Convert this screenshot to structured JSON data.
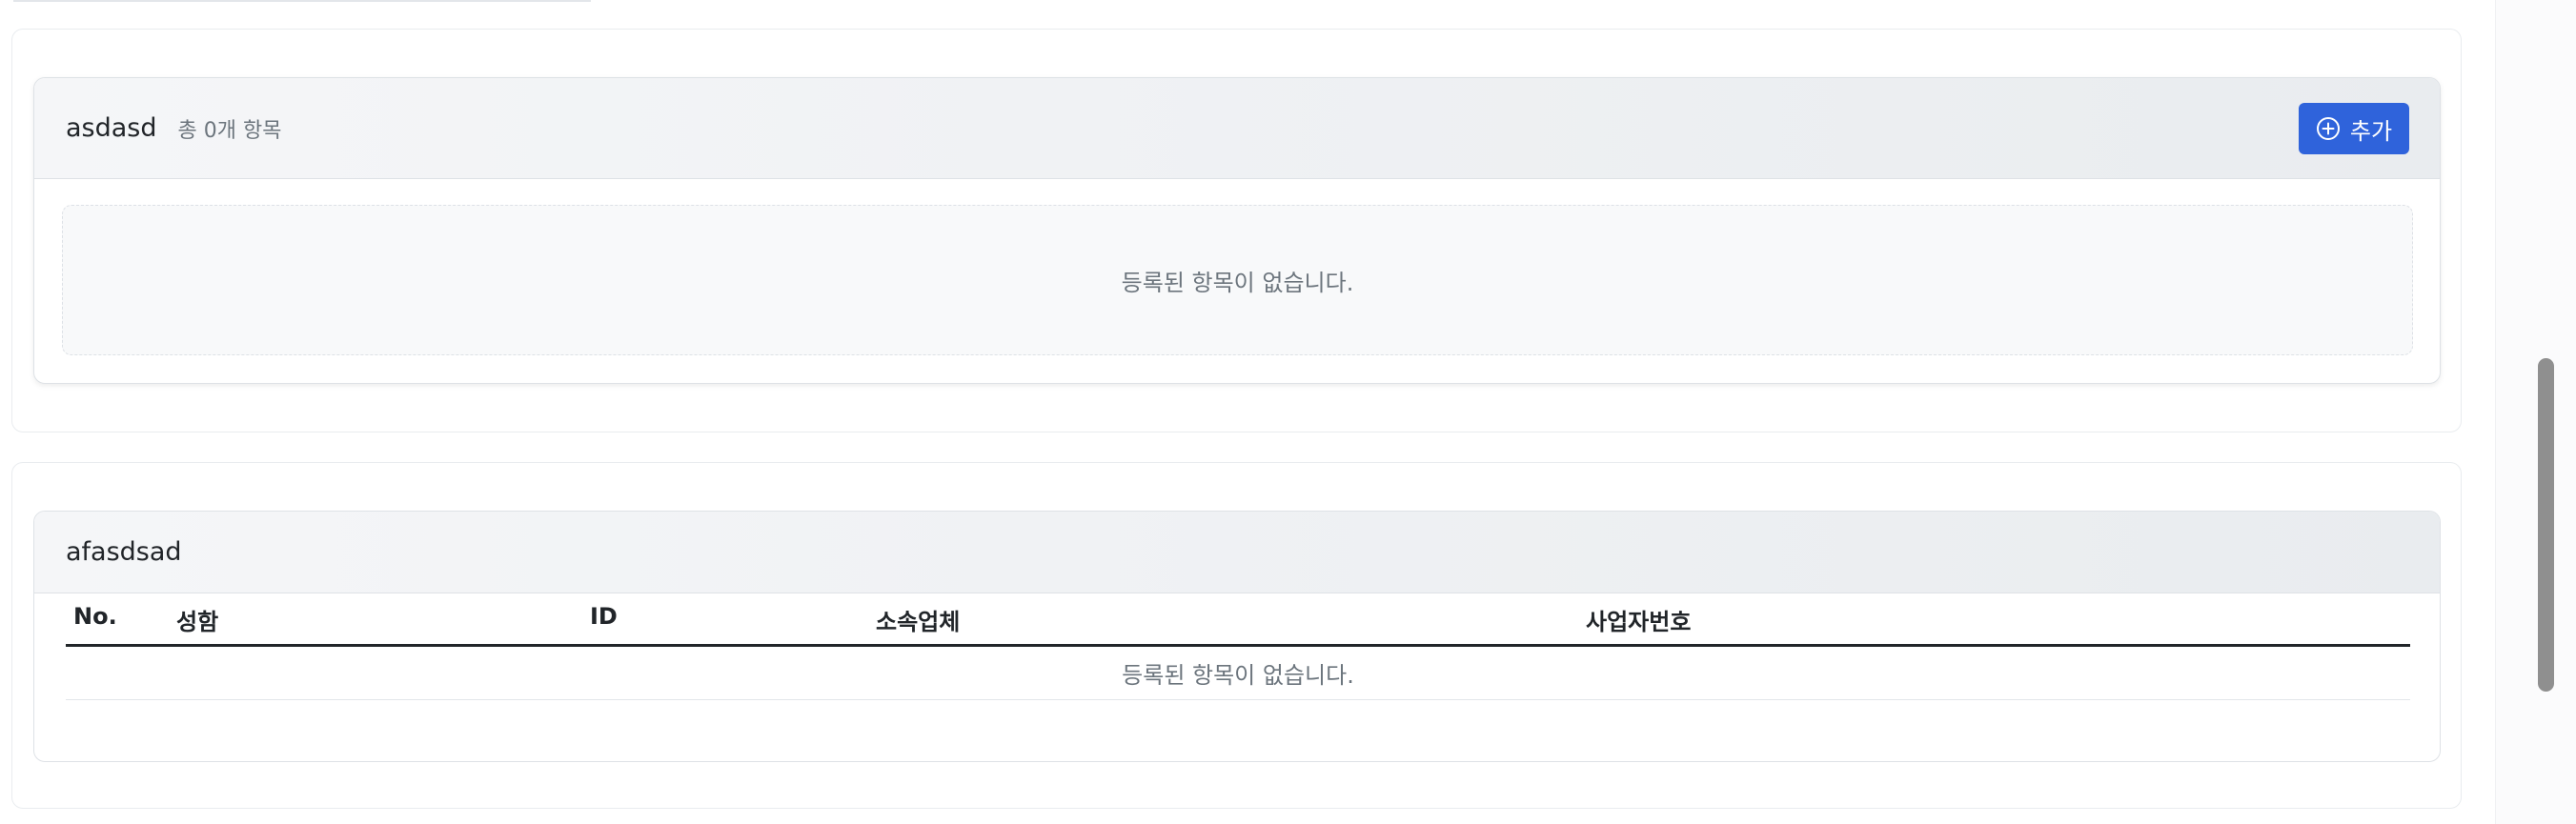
{
  "section1": {
    "title": "asdasd",
    "count_label": "총 0개 항목",
    "add_button_label": "추가",
    "empty_message": "등록된 항목이 없습니다."
  },
  "section2": {
    "title": "afasdsad",
    "columns": [
      "No.",
      "성함",
      "ID",
      "소속업체",
      "사업자번호"
    ],
    "empty_message": "등록된 항목이 없습니다."
  },
  "colors": {
    "accent": "#2f63db",
    "header_bg": "#eceef1",
    "muted_text": "#6c757d"
  }
}
